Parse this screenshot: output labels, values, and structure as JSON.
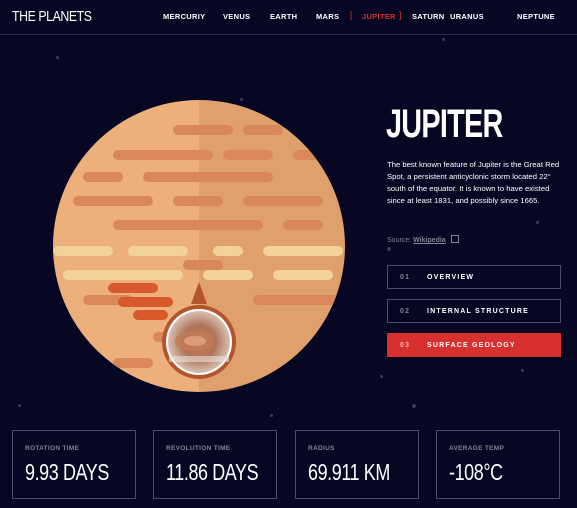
{
  "header": {
    "logo": "THE PLANETS",
    "nav": [
      {
        "label": "MERCURIY",
        "active": false
      },
      {
        "label": "VENUS",
        "active": false
      },
      {
        "label": "EARTH",
        "active": false
      },
      {
        "label": "MARS",
        "active": false
      },
      {
        "label": "JUPITER",
        "active": true
      },
      {
        "label": "SATURN",
        "active": false
      },
      {
        "label": "URANUS",
        "active": false
      },
      {
        "label": "NEPTUNE",
        "active": false
      }
    ],
    "active_bracket_left": "[",
    "active_bracket_right": "]"
  },
  "planet": {
    "name": "JUPITER",
    "description": "The best known feature of Jupiter is the Great Red Spot, a persistent anticyclonic storm located 22° south of the equator. It is known to have existed since at least 1831, and possibly since 1665.",
    "source_label": "Source:",
    "source_link": "Wikipedia",
    "source_icon": "external-link-icon"
  },
  "tabs": [
    {
      "num": "01",
      "label": "OVERVIEW",
      "active": false
    },
    {
      "num": "02",
      "label": "INTERNAL STRUCTURE",
      "active": false
    },
    {
      "num": "03",
      "label": "SURFACE GEOLOGY",
      "active": true
    }
  ],
  "stats": [
    {
      "label": "ROTATION TIME",
      "value": "9.93 DAYS"
    },
    {
      "label": "REVOLUTION TIME",
      "value": "11.86 DAYS"
    },
    {
      "label": "RADIUS",
      "value": "69.911 KM"
    },
    {
      "label": "AVERAGE TEMP",
      "value": "-108°C"
    }
  ],
  "colors": {
    "background": "#070724",
    "accent": "#D8302E",
    "muted": "#838391"
  }
}
